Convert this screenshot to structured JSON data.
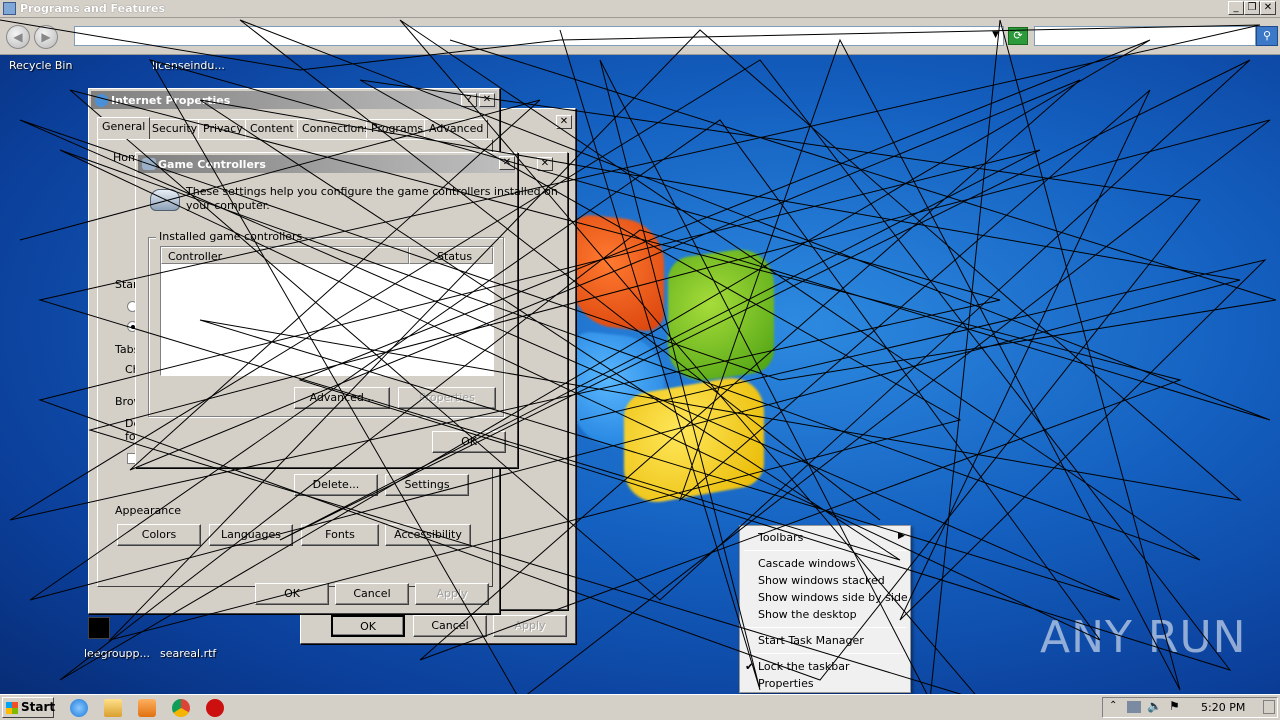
{
  "explorer": {
    "title": "Programs and Features",
    "address": "",
    "search_placeholder": ""
  },
  "desktop": {
    "icons": [
      "Recycle Bin",
      "licenseindu...",
      "leegroupp...",
      "seareal.rtf"
    ]
  },
  "internet_properties": {
    "title": "Internet Properties",
    "tabs": [
      "General",
      "Security",
      "Privacy",
      "Content",
      "Connections",
      "Programs",
      "Advanced"
    ],
    "fragments": [
      "Home",
      "Star",
      "Tabs",
      "Ch",
      "Brow",
      "De",
      "fo"
    ],
    "buttons": {
      "delete": "Delete...",
      "settings": "Settings",
      "colors": "Colors",
      "languages": "Languages",
      "fonts": "Fonts",
      "accessibility": "Accessibility",
      "ok": "OK",
      "cancel": "Cancel",
      "apply": "Apply"
    },
    "appearance_label": "Appearance"
  },
  "back_dialog": {
    "buttons": {
      "ok": "OK",
      "cancel": "Cancel",
      "apply": "Apply"
    }
  },
  "game_controllers": {
    "title": "Game Controllers",
    "description_line1": "These settings help you configure the game controllers installed on",
    "description_line2": "your computer.",
    "group_label": "Installed game controllers",
    "columns": [
      "Controller",
      "Status"
    ],
    "rows": [],
    "buttons": {
      "advanced": "Advanced...",
      "properties": "Properties",
      "ok": "OK"
    }
  },
  "context_menu": {
    "items": [
      {
        "label": "Toolbars",
        "submenu": true
      },
      {
        "label": "Cascade windows"
      },
      {
        "label": "Show windows stacked"
      },
      {
        "label": "Show windows side by side"
      },
      {
        "label": "Show the desktop"
      },
      {
        "label": "Start Task Manager"
      },
      {
        "label": "Lock the taskbar",
        "checked": true
      },
      {
        "label": "Properties"
      }
    ]
  },
  "taskbar": {
    "start_label": "Start",
    "clock": "5:20 PM"
  },
  "watermark": "ANY RUN",
  "colors": {
    "desktop": "#1460c0",
    "window_face": "#d4d0c8",
    "title_inactive": "#808080"
  }
}
